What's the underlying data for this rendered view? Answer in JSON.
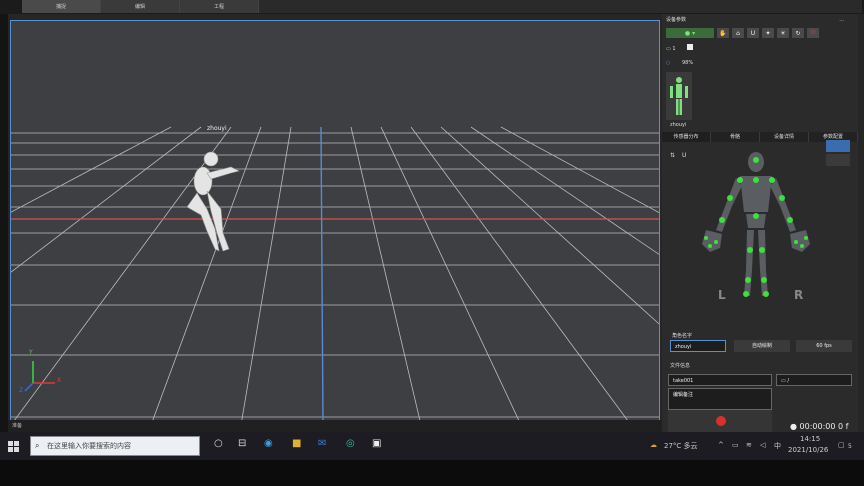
{
  "tabs": [
    "捕捉",
    "编辑",
    "工程"
  ],
  "viewport": {
    "character_label": "zhouyi",
    "axis_x": "X",
    "axis_y": "Y",
    "axis_z": "Z"
  },
  "status": {
    "text": "准备"
  },
  "panel": {
    "header": "设备参数",
    "menu_dots": "...",
    "device_index": "1",
    "battery": "98%",
    "thumb_name": "zhouyi",
    "tabs": [
      "传感器分布",
      "骨骼",
      "设备详情",
      "参数配置"
    ],
    "left_label": "L",
    "right_label": "R",
    "name_title": "角色名字",
    "name_value": "zhouyi",
    "auto_btn": "自动绘制",
    "fps": "60 fps",
    "file_title": "文件信息",
    "take": "take001",
    "path": "/",
    "note": "编辑备注",
    "timecode": "00:00:00 0 f"
  },
  "taskbar": {
    "search_placeholder": "在这里输入你要搜索的内容",
    "weather": "27°C 多云",
    "ime": "中",
    "time": "14:15",
    "date": "2021/10/26",
    "notif_count": "5"
  }
}
